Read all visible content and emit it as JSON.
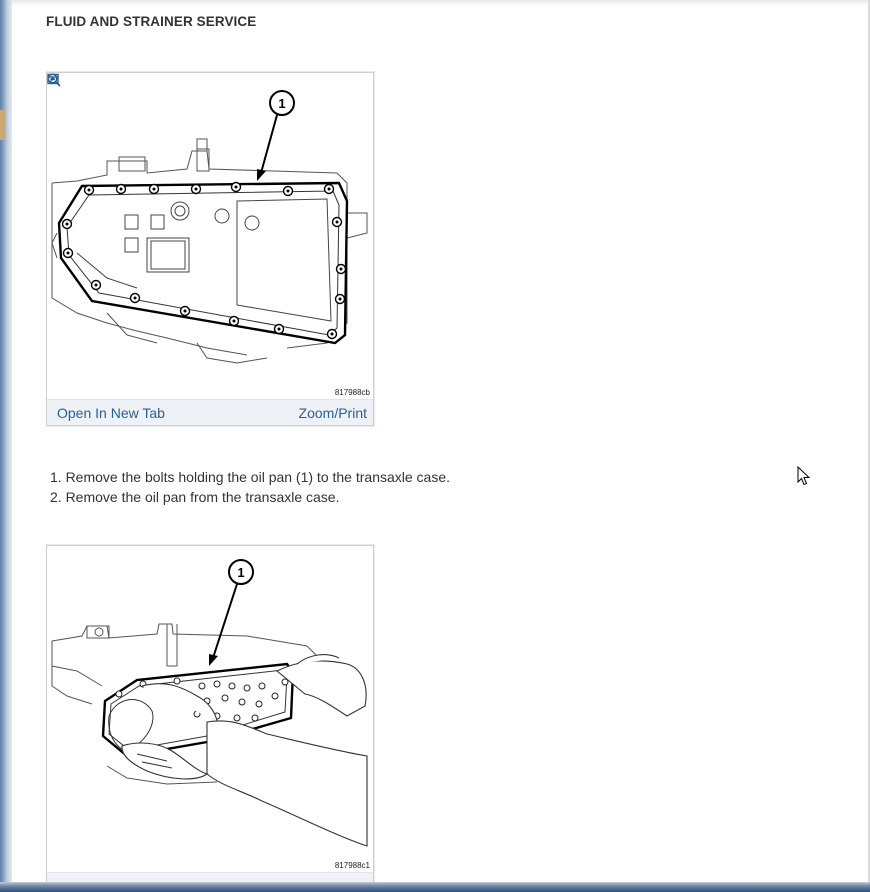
{
  "page": {
    "title": "FLUID AND STRAINER SERVICE"
  },
  "figures": [
    {
      "callout": "1",
      "code": "817988cb",
      "open_label": "Open In New Tab",
      "zoom_label": "Zoom/Print"
    },
    {
      "callout": "1",
      "code": "817988c1"
    }
  ],
  "steps": [
    "1. Remove the bolts holding the oil pan (1) to the transaxle case.",
    "2. Remove the oil pan from the transaxle case."
  ],
  "icons": {
    "open": "open-in-new-tab-icon",
    "zoom": "zoom-in-icon",
    "cursor": "mouse-pointer-icon"
  },
  "colors": {
    "link": "#2a5f95",
    "toolbar": "#eef1f6",
    "window_frame": "#2f4f78"
  }
}
